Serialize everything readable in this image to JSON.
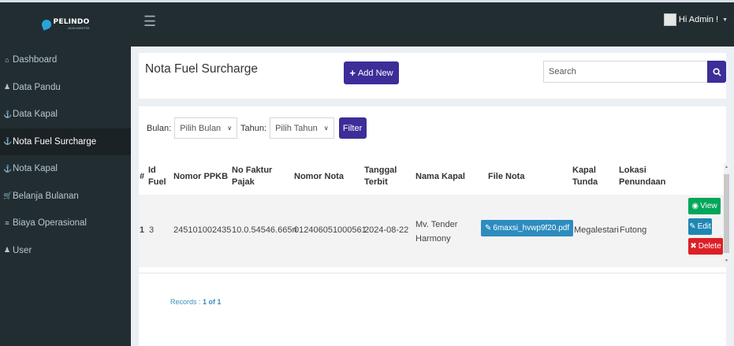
{
  "header": {
    "logo_text": "PELINDO",
    "logo_subtext": "JASA MARITIM",
    "admin_label": "Hi Admin !"
  },
  "sidebar": {
    "items": [
      {
        "label": "Dashboard",
        "icon": "home-icon"
      },
      {
        "label": "Data Pandu",
        "icon": "users-icon"
      },
      {
        "label": "Data Kapal",
        "icon": "ship-icon"
      },
      {
        "label": "Nota Fuel Surcharge",
        "icon": "anchor-icon"
      },
      {
        "label": "Nota Kapal",
        "icon": "ship-icon"
      },
      {
        "label": "Belanja Bulanan",
        "icon": "cart-icon"
      },
      {
        "label": "Biaya Operasional",
        "icon": "database-icon"
      },
      {
        "label": "User",
        "icon": "user-icon"
      }
    ],
    "active_index": 3
  },
  "page": {
    "title": "Nota Fuel Surcharge",
    "add_button": "Add New",
    "search_placeholder": "Search"
  },
  "filter": {
    "bulan_label": "Bulan:",
    "bulan_value": "Pilih Bulan",
    "tahun_label": "Tahun:",
    "tahun_value": "Pilih Tahun",
    "button": "Filter"
  },
  "table": {
    "columns": [
      "#",
      "Id Fuel",
      "Nomor PPKB",
      "No Faktur Pajak",
      "Nomor Nota",
      "Tanggal Terbit",
      "Nama Kapal",
      "File Nota",
      "Kapal Tunda",
      "Lokasi Penundaan"
    ],
    "rows": [
      {
        "no": "1",
        "id_fuel": "3",
        "nomor_ppkb": "245101002435",
        "no_faktur_pajak": "10.0.54546.665ri",
        "nomor_nota": "012406051000561",
        "tanggal_terbit": "2024-08-22",
        "nama_kapal": "Mv. Tender Harmony",
        "file_nota": "6maxsi_hvwp9f20.pdf",
        "kapal_tunda": "Megalestari",
        "lokasi_penundaan": "Futong"
      }
    ],
    "actions": {
      "view": "View",
      "edit": "Edit",
      "delete": "Delete"
    }
  },
  "records": {
    "label": "Records :",
    "value": "1 of 1"
  },
  "colors": {
    "sidebar": "#222d32",
    "primary": "#3c2d99",
    "view": "#00a65a",
    "edit": "#1f86b3",
    "delete": "#dd1f27",
    "file": "#2d8cbf"
  }
}
